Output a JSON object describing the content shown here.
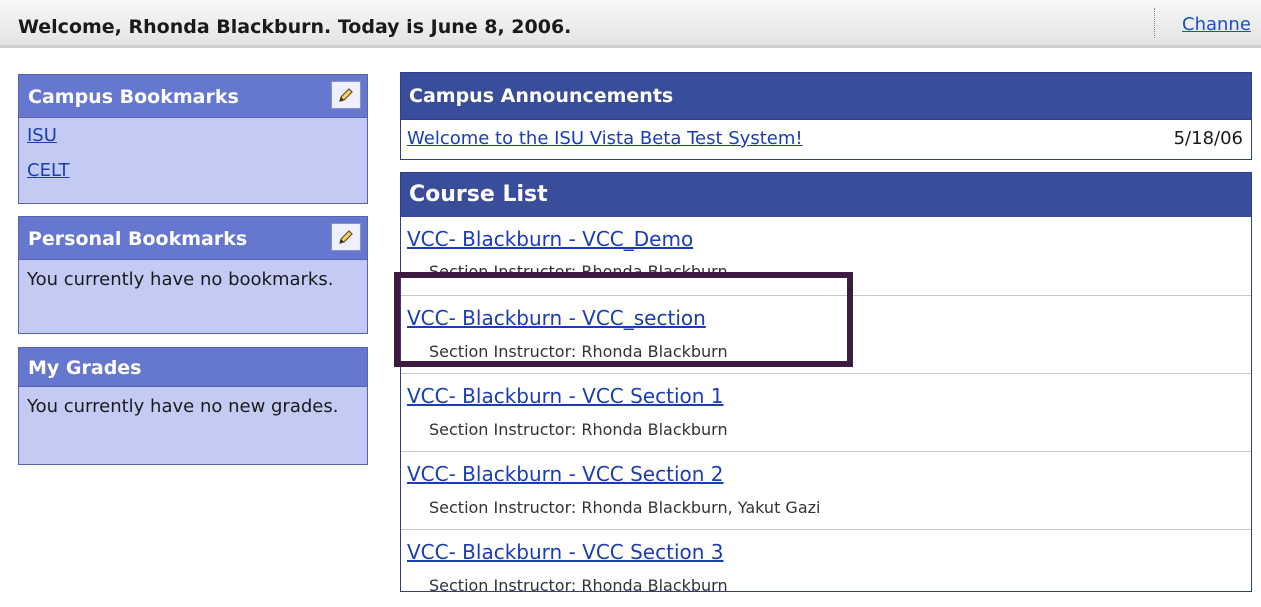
{
  "header": {
    "welcome": "Welcome, Rhonda Blackburn. Today is June 8, 2006.",
    "channels_label": "Channe"
  },
  "sidebar": {
    "campus_bookmarks": {
      "title": "Campus Bookmarks",
      "links": [
        "ISU",
        "CELT"
      ]
    },
    "personal_bookmarks": {
      "title": "Personal Bookmarks",
      "message": "You currently have no bookmarks."
    },
    "my_grades": {
      "title": "My Grades",
      "message": "You currently have no new grades."
    }
  },
  "announcements": {
    "title": "Campus Announcements",
    "items": [
      {
        "text": "Welcome to the ISU Vista Beta Test System!",
        "date": "5/18/06"
      }
    ]
  },
  "course_list": {
    "title": "Course List",
    "courses": [
      {
        "name": "VCC- Blackburn - VCC_Demo",
        "instructor": "Section Instructor: Rhonda Blackburn"
      },
      {
        "name": "VCC- Blackburn - VCC_section",
        "instructor": "Section Instructor: Rhonda Blackburn"
      },
      {
        "name": "VCC- Blackburn - VCC Section 1",
        "instructor": "Section Instructor: Rhonda Blackburn"
      },
      {
        "name": "VCC- Blackburn - VCC Section 2",
        "instructor": "Section Instructor: Rhonda Blackburn, Yakut Gazi"
      },
      {
        "name": "VCC- Blackburn - VCC Section 3",
        "instructor": "Section Instructor: Rhonda Blackburn"
      }
    ]
  },
  "colors": {
    "sidebar_header": "#6677cf",
    "sidebar_body": "#c3cbf5",
    "main_header": "#3a4d9a",
    "link": "#1a3cb5",
    "highlight_box": "#3e1a42"
  }
}
